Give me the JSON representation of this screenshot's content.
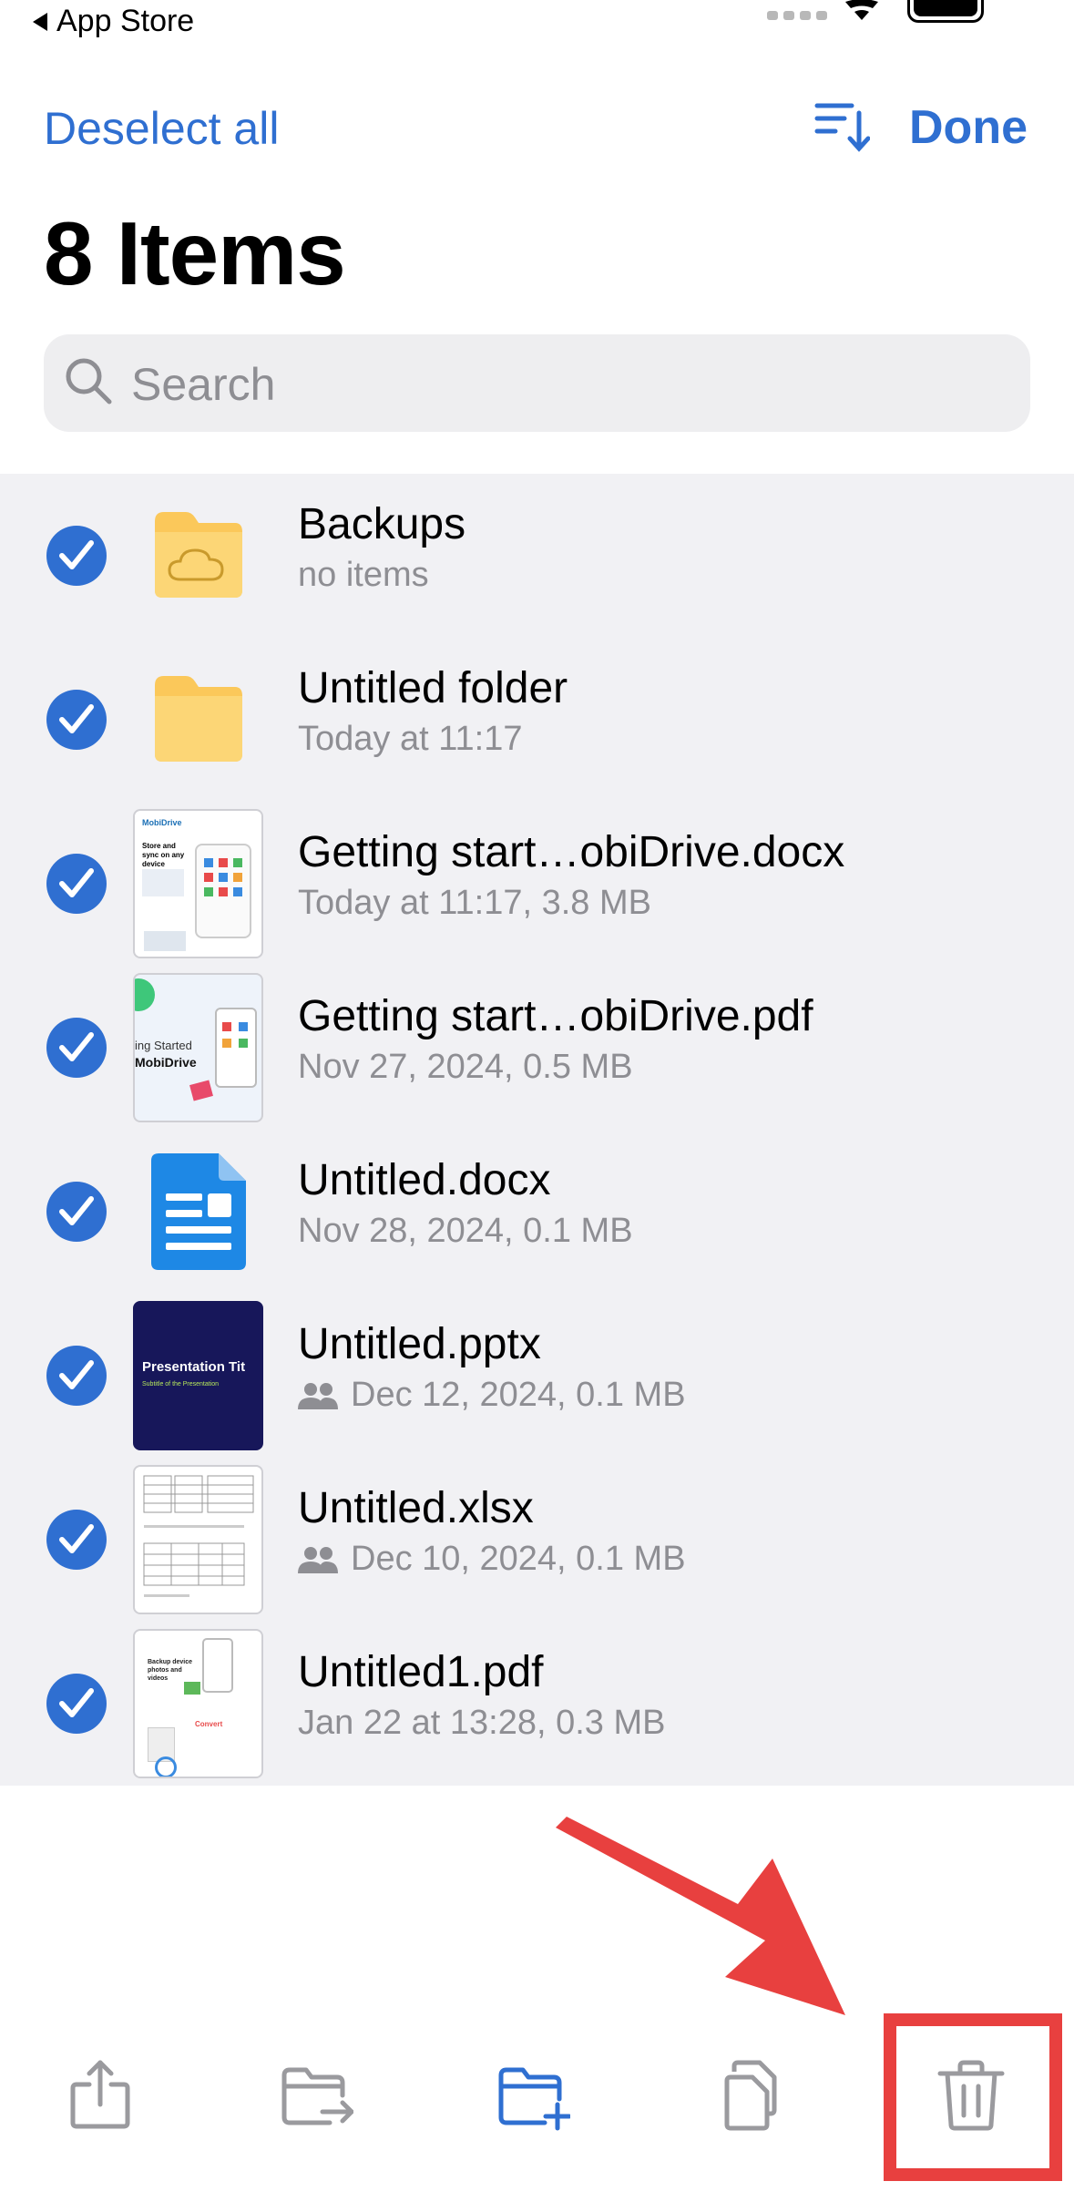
{
  "status": {
    "back_label": "App Store"
  },
  "nav": {
    "deselect_label": "Deselect all",
    "done_label": "Done"
  },
  "title": "8 Items",
  "search": {
    "placeholder": "Search"
  },
  "files": [
    {
      "name": "Backups",
      "meta": "no items",
      "type": "cloud-folder",
      "shared": false
    },
    {
      "name": "Untitled folder",
      "meta": "Today at 11:17",
      "type": "folder",
      "shared": false
    },
    {
      "name": "Getting start…obiDrive.docx",
      "meta": "Today at 11:17, 3.8 MB",
      "type": "docx-preview",
      "shared": false,
      "thumb_text": [
        "MobiDrive",
        "Store and sync on any device"
      ]
    },
    {
      "name": "Getting start…obiDrive.pdf",
      "meta": "Nov 27, 2024, 0.5 MB",
      "type": "pdf-preview",
      "shared": false,
      "thumb_text": [
        "ing Started",
        "MobiDrive"
      ]
    },
    {
      "name": "Untitled.docx",
      "meta": "Nov 28, 2024, 0.1 MB",
      "type": "docx-icon",
      "shared": false
    },
    {
      "name": "Untitled.pptx",
      "meta": "Dec 12, 2024, 0.1 MB",
      "type": "pptx-preview",
      "shared": true,
      "thumb_text": [
        "Presentation Tit",
        "Subtitle of the Presentation"
      ]
    },
    {
      "name": "Untitled.xlsx",
      "meta": "Dec 10, 2024, 0.1 MB",
      "type": "xlsx-preview",
      "shared": true
    },
    {
      "name": "Untitled1.pdf",
      "meta": "Jan 22 at 13:28, 0.3 MB",
      "type": "pdf2-preview",
      "shared": false,
      "thumb_text": [
        "Backup device photos and videos",
        "Convert"
      ]
    }
  ],
  "colors": {
    "accent": "#2f6fd1",
    "annotation": "#e8403f",
    "list_bg": "#f1f1f4"
  },
  "toolbar": {
    "icons": [
      "share-icon",
      "move-icon",
      "new-folder-icon",
      "copy-icon",
      "trash-icon"
    ]
  }
}
